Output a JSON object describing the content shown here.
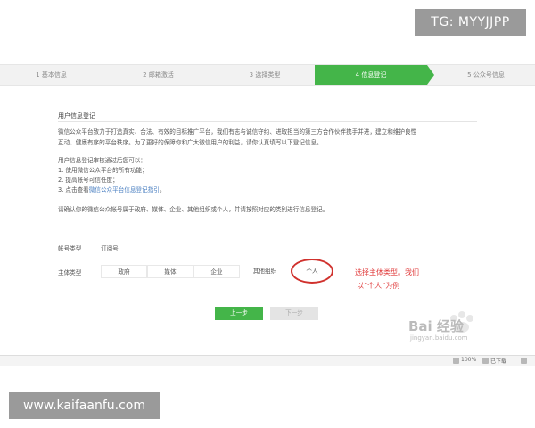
{
  "tg_label": "TG: MYYJJPP",
  "steps": [
    {
      "label": "1 基本信息"
    },
    {
      "label": "2 邮箱激活"
    },
    {
      "label": "3 选择类型"
    },
    {
      "label": "4 信息登记"
    },
    {
      "label": "5 公众号信息"
    }
  ],
  "section": {
    "title": "用户信息登记",
    "para1_line1": "微信公众平台致力于打造真实、合法、有效的目标推广平台，我们有志与诚信守约、进取担当的第三方合作伙伴携手并进，建立和维护良性",
    "para1_line2": "互动、健康有序的平台秩序。为了更好的保障你和广大微信用户的利益，请你认真填写以下登记信息。",
    "para2_head": "用户信息登记审核通过后您可以：",
    "para2_item1": "1. 使用微信公众平台的所有功能；",
    "para2_item2": "2. 提高帐号可信任度；",
    "para2_item3_prefix": "3. 点击查看",
    "para2_item3_link": "微信公众平台信息登记指引",
    "para2_item3_suffix": "。",
    "para3": "请确认你的微信公众帐号属于政府、媒体、企业、其他组织或个人，并请按照对应的类别进行信息登记。"
  },
  "account_type": {
    "label": "帐号类型",
    "value": "订阅号"
  },
  "subject_type": {
    "label": "主体类型",
    "options": [
      "政府",
      "媒体",
      "企业",
      "其他组织",
      "个人"
    ]
  },
  "annotation": {
    "line1": "选择主体类型。我们",
    "line2": "以“个人”为例"
  },
  "buttons": {
    "prev": "上一步",
    "next": "下一步"
  },
  "watermark": {
    "text": "Bai 经验",
    "sub": "jingyan.baidu.com"
  },
  "bottombar": {
    "item1": "100%",
    "item2": "已下载"
  },
  "site_label": "www.kaifaanfu.com",
  "colors": {
    "accent": "#44b549",
    "annotation": "#e03a3a",
    "link": "#4a7fc1"
  }
}
